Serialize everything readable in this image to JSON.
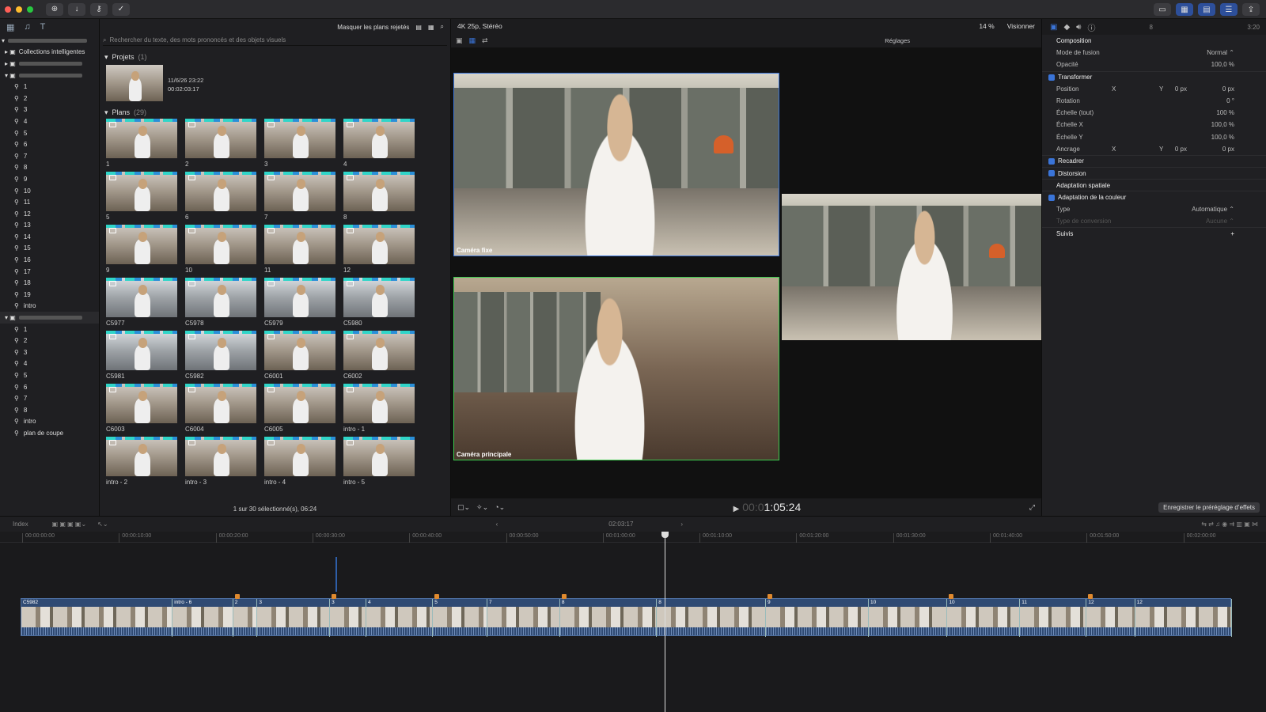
{
  "colors": {
    "accent": "#3a74d8",
    "green_angle": "#3ccc4e",
    "blue_angle": "#3a74d8",
    "marker": "#e08a2e",
    "clip": "#2f4a73"
  },
  "browser": {
    "filter_label": "Masquer les plans rejetés",
    "search_placeholder": "Rechercher du texte, des mots prononcés et des objets visuels",
    "projects_label": "Projets",
    "projects_count": "(1)",
    "project": {
      "date": "11/6/26 23:22",
      "duration": "00:02:03:17"
    },
    "plans_label": "Plans",
    "plans_count": "(29)",
    "clips": [
      "1",
      "2",
      "3",
      "4",
      "5",
      "6",
      "7",
      "8",
      "9",
      "10",
      "11",
      "12",
      "C5977",
      "C5978",
      "C5979",
      "C5980",
      "C5981",
      "C5982",
      "C6001",
      "C6002",
      "C6003",
      "C6004",
      "C6005",
      "intro - 1",
      "intro - 2",
      "intro - 3",
      "intro - 4",
      "intro - 5"
    ],
    "footer": "1 sur 30 sélectionné(s), 06:24"
  },
  "library": {
    "smart_collections": "Collections intelligentes",
    "group1": [
      "1",
      "2",
      "3",
      "4",
      "5",
      "6",
      "7",
      "8",
      "9",
      "10",
      "11",
      "12",
      "13",
      "14",
      "15",
      "16",
      "17",
      "18",
      "19",
      "intro"
    ],
    "group2": [
      "1",
      "2",
      "3",
      "4",
      "5",
      "6",
      "7",
      "8",
      "intro",
      "plan de coupe"
    ]
  },
  "viewer": {
    "format": "4K 25p, Stéréo",
    "zoom": "14 %",
    "view_menu": "Visionner",
    "settings": "Réglages",
    "angle_top": "Caméra fixe",
    "angle_bottom": "Caméra principale",
    "timecode_dim": "00:0",
    "timecode": "1:05:24"
  },
  "inspector": {
    "tab_value": "8",
    "time": "3:20",
    "composition": "Composition",
    "blend_label": "Mode de fusion",
    "blend_value": "Normal ⌃",
    "opacity_label": "Opacité",
    "opacity_value": "100,0 %",
    "transform": "Transformer",
    "position_label": "Position",
    "position_x_label": "X",
    "position_x": "0 px",
    "position_y_label": "Y",
    "position_y": "0 px",
    "rotation_label": "Rotation",
    "rotation_value": "0 °",
    "scale_all_label": "Échelle (tout)",
    "scale_all": "100 %",
    "scale_x_label": "Échelle X",
    "scale_x": "100,0 %",
    "scale_y_label": "Échelle Y",
    "scale_y": "100,0 %",
    "anchor_label": "Ancrage",
    "anchor_x_label": "X",
    "anchor_x": "0 px",
    "anchor_y_label": "Y",
    "anchor_y": "0 px",
    "crop": "Recadrer",
    "distortion": "Distorsion",
    "spatial": "Adaptation spatiale",
    "color_adapt": "Adaptation de la couleur",
    "type_label": "Type",
    "type_value": "Automatique ⌃",
    "conversion_label": "Type de conversion",
    "conversion_value": "Aucune ⌃",
    "tracking": "Suivis",
    "save_preset": "Enregistrer le préréglage d’effets"
  },
  "timeline": {
    "index": "Index",
    "duration": "02:03:17",
    "ruler": [
      "00:00:00:00",
      "00:00:10:00",
      "00:00:20:00",
      "00:00:30:00",
      "00:00:40:00",
      "00:00:50:00",
      "00:01:00:00",
      "00:01:10:00",
      "00:01:20:00",
      "00:01:30:00",
      "00:01:40:00",
      "00:01:50:00",
      "00:02:00:00"
    ],
    "clips": [
      {
        "name": "C5982",
        "start": 0,
        "w": 0.125
      },
      {
        "name": "intro - 6",
        "start": 0.125,
        "w": 0.05
      },
      {
        "name": "2",
        "start": 0.175,
        "w": 0.02
      },
      {
        "name": "3",
        "start": 0.195,
        "w": 0.06
      },
      {
        "name": "3",
        "start": 0.255,
        "w": 0.03
      },
      {
        "name": "4",
        "start": 0.285,
        "w": 0.055
      },
      {
        "name": "5",
        "start": 0.34,
        "w": 0.045
      },
      {
        "name": "7",
        "start": 0.385,
        "w": 0.06
      },
      {
        "name": "8",
        "start": 0.445,
        "w": 0.08
      },
      {
        "name": "8",
        "start": 0.525,
        "w": 0.09
      },
      {
        "name": "9",
        "start": 0.615,
        "w": 0.085
      },
      {
        "name": "10",
        "start": 0.7,
        "w": 0.065
      },
      {
        "name": "10",
        "start": 0.765,
        "w": 0.06
      },
      {
        "name": "11",
        "start": 0.825,
        "w": 0.055
      },
      {
        "name": "12",
        "start": 0.88,
        "w": 0.04
      },
      {
        "name": "12",
        "start": 0.92,
        "w": 0.08
      }
    ]
  }
}
